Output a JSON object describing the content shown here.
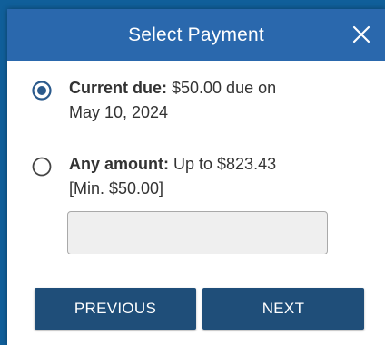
{
  "header": {
    "title": "Select Payment"
  },
  "options": [
    {
      "label": "Current due:",
      "line1": " $50.00 due on",
      "line2": "May 10, 2024",
      "selected": true
    },
    {
      "label": "Any amount:",
      "line1": " Up to $823.43",
      "line2": "[Min. $50.00]",
      "selected": false
    }
  ],
  "amount_input": {
    "value": "",
    "placeholder": ""
  },
  "buttons": {
    "previous_label": "PREVIOUS",
    "next_label": "NEXT"
  },
  "colors": {
    "background": "#105f9a",
    "header": "#2a68ad",
    "button": "#1f4e79",
    "radio": "#2b5a8c"
  },
  "icons": {
    "close": "close-icon",
    "radio_selected": "radio-selected-icon",
    "radio_unselected": "radio-unselected-icon"
  }
}
